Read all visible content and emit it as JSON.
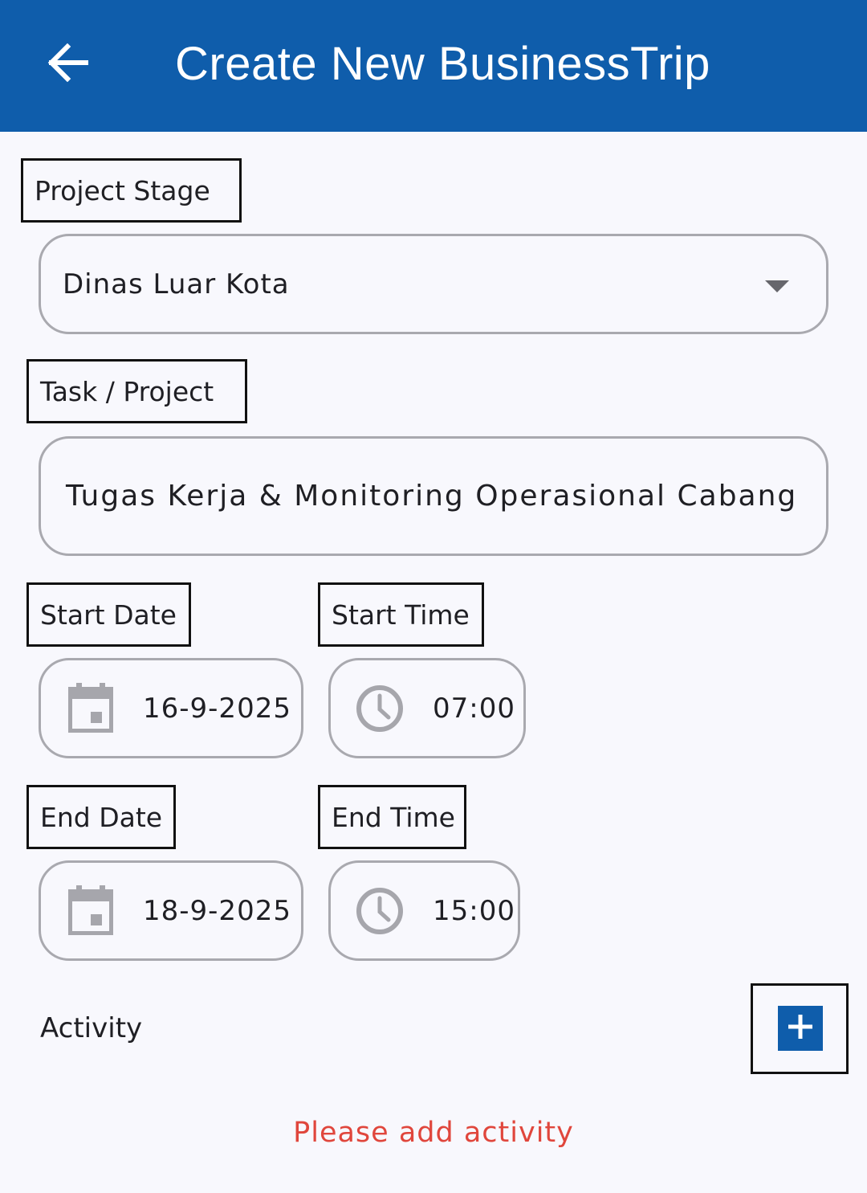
{
  "appbar": {
    "title": "Create New BusinessTrip",
    "back_icon": "arrow-left-icon",
    "background": "#0f5dab"
  },
  "project_stage": {
    "label": "Project Stage",
    "value": "Dinas Luar Kota",
    "icon": "dropdown-caret-icon"
  },
  "task": {
    "label": "Task / Project",
    "value": "Tugas Kerja & Monitoring Operasional Cabang"
  },
  "start": {
    "date_label": "Start Date",
    "date_value": "16-9-2025",
    "time_label": "Start Time",
    "time_value": "07:00"
  },
  "end": {
    "date_label": "End Date",
    "date_value": "18-9-2025",
    "time_label": "End Time",
    "time_value": "15:00"
  },
  "activity": {
    "label": "Activity",
    "add_icon": "plus-icon",
    "empty_message": "Please add activity",
    "empty_message_color": "#e0463c"
  }
}
